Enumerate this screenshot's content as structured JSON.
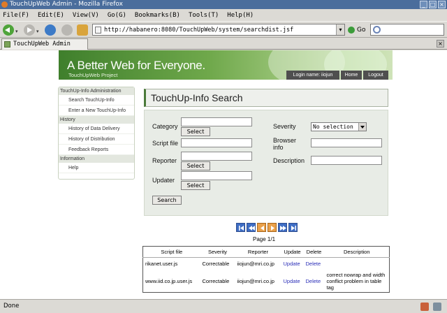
{
  "window": {
    "title": "TouchUpWeb Admin - Mozilla Firefox"
  },
  "menu": [
    "File(F)",
    "Edit(E)",
    "View(V)",
    "Go(G)",
    "Bookmarks(B)",
    "Tools(T)",
    "Help(H)"
  ],
  "nav": {
    "url": "http://habanero:8080/TouchUpWeb/system/searchdist.jsf",
    "go_label": "Go"
  },
  "tab": {
    "label": "TouchUpWeb Admin"
  },
  "banner": {
    "tagline": "A Better Web for Everyone.",
    "project": "TouchUpWeb Project",
    "login_label": "Login name: iiojun",
    "home_label": "Home",
    "logout_label": "Logout"
  },
  "sidebar": {
    "sections": [
      {
        "heading": "TouchUp-Info Administration",
        "items": [
          "Search TouchUp-Info",
          "Enter a New TouchUp-Info"
        ]
      },
      {
        "heading": "History",
        "items": [
          "History of Data Delivery",
          "History of Distribution",
          "Feedback Reports"
        ]
      },
      {
        "heading": "Information",
        "items": [
          "Help"
        ]
      }
    ]
  },
  "page": {
    "title": "TouchUp-Info Search"
  },
  "form": {
    "category_label": "Category",
    "script_file_label": "Script file",
    "reporter_label": "Reporter",
    "updater_label": "Updater",
    "select_label": "Select",
    "search_label": "Search",
    "severity_label": "Severity",
    "severity_value": "No selection",
    "browser_info_label": "Browser info",
    "description_label": "Description"
  },
  "pager": {
    "page_info": "Page 1/1"
  },
  "table": {
    "columns": [
      "Script file",
      "Severity",
      "Reporter",
      "Update",
      "Delete",
      "Description"
    ],
    "rows": [
      [
        "rikanet.user.js",
        "Correctable",
        "iiojun@mri.co.jp",
        "Update",
        "Delete",
        ""
      ],
      [
        "www.iid.co.jp.user.js",
        "Correctable",
        "iiojun@mri.co.jp",
        "Update",
        "Delete",
        "correct nowrap and width conflict problem in table tag"
      ]
    ]
  },
  "status": {
    "text": "Done"
  },
  "colors": {
    "link": "#2b2fb8",
    "pager_blue": "#3e6dc4",
    "pager_orange": "#e9a04a",
    "banner_green": "#5f9a3f"
  }
}
